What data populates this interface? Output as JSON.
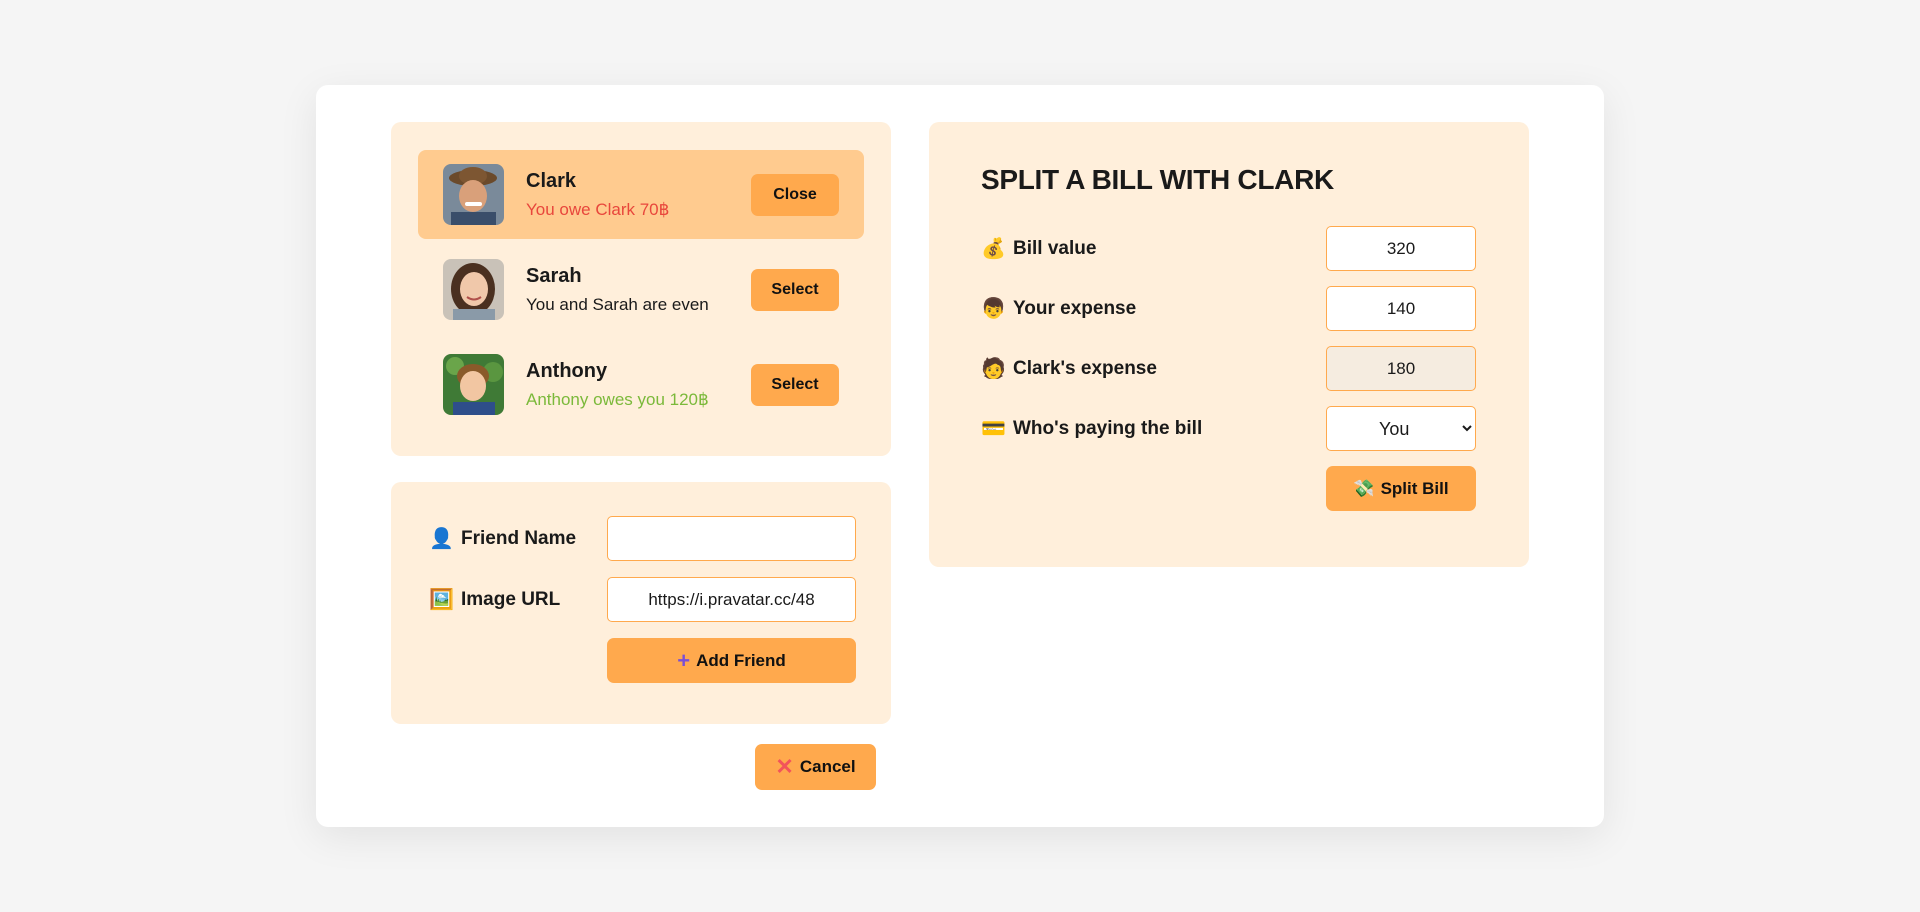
{
  "friends": [
    {
      "name": "Clark",
      "status": "You owe Clark 70฿",
      "status_type": "red",
      "button": "Close",
      "selected": true,
      "avatar": "avatar-clark"
    },
    {
      "name": "Sarah",
      "status": "You and Sarah are even",
      "status_type": "neutral",
      "button": "Select",
      "selected": false,
      "avatar": "avatar-sarah"
    },
    {
      "name": "Anthony",
      "status": "Anthony owes you 120฿",
      "status_type": "green",
      "button": "Select",
      "selected": false,
      "avatar": "avatar-anthony"
    }
  ],
  "add_friend": {
    "name_label": "Friend Name",
    "name_icon": "👤",
    "name_value": "",
    "image_label": "Image URL",
    "image_icon": "🖼️",
    "image_value": "https://i.pravatar.cc/48",
    "button_icon": "+",
    "button_label": "Add Friend"
  },
  "cancel": {
    "icon": "✕",
    "label": "Cancel"
  },
  "split": {
    "title": "SPLIT A BILL WITH CLARK",
    "bill_value_icon": "💰",
    "bill_value_label": "Bill value",
    "bill_value": "320",
    "your_expense_icon": "👦",
    "your_expense_label": "Your expense",
    "your_expense": "140",
    "friend_expense_icon": "🧑",
    "friend_expense_label": "Clark's expense",
    "friend_expense": "180",
    "payer_icon": "💳",
    "payer_label": "Who's paying the bill",
    "payer_value": "You",
    "button_icon": "💸",
    "button_label": "Split Bill"
  },
  "colors": {
    "accent": "#ffa94d",
    "panel": "#ffefdb",
    "selected": "#ffcb8f",
    "red": "#e8473c",
    "green": "#7bb93a"
  }
}
